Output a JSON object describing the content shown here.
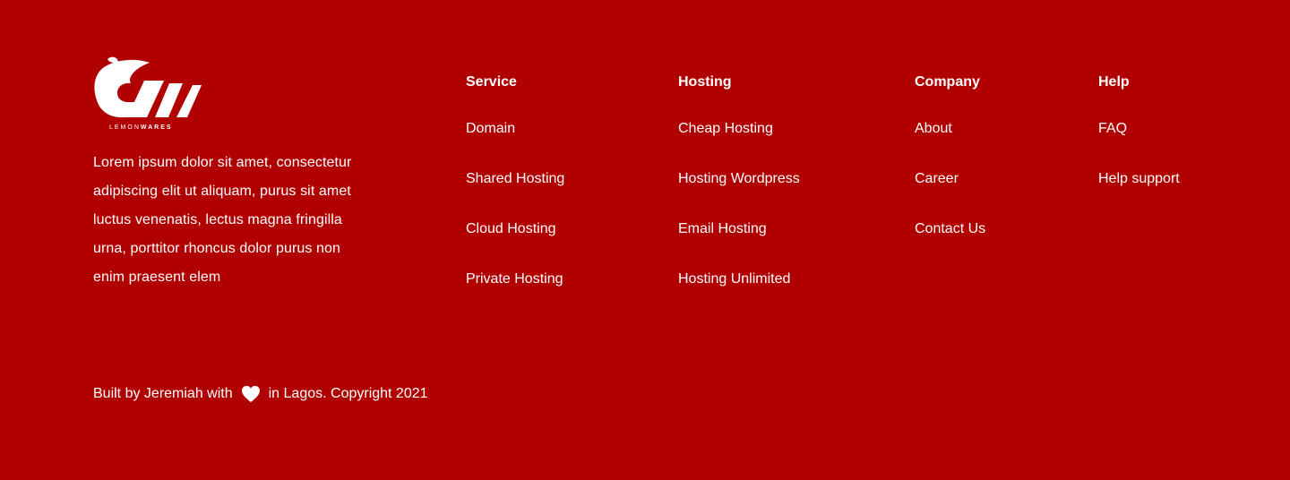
{
  "brand": {
    "logo_icon": "lemonwares-logo-icon",
    "logo_text_light": "LEMON",
    "logo_text_bold": "WARES",
    "description": "Lorem ipsum dolor sit amet, consectetur adipiscing elit ut aliquam, purus sit amet luctus venenatis, lectus magna fringilla urna, porttitor rhoncus dolor purus non enim praesent elem"
  },
  "columns": [
    {
      "title": "Service",
      "links": [
        "Domain",
        "Shared Hosting",
        "Cloud Hosting",
        "Private Hosting"
      ]
    },
    {
      "title": "Hosting",
      "links": [
        "Cheap Hosting",
        "Hosting Wordpress",
        "Email Hosting",
        "Hosting Unlimited"
      ]
    },
    {
      "title": "Company",
      "links": [
        "About",
        "Career",
        "Contact Us"
      ]
    },
    {
      "title": "Help",
      "links": [
        "FAQ",
        "Help support"
      ]
    }
  ],
  "copyright": {
    "before_icon": "Built by Jeremiah with",
    "icon": "heart-icon",
    "after_icon": "in Lagos. Copyright 2021"
  },
  "colors": {
    "background": "#b00000",
    "text": "#ffffff"
  }
}
